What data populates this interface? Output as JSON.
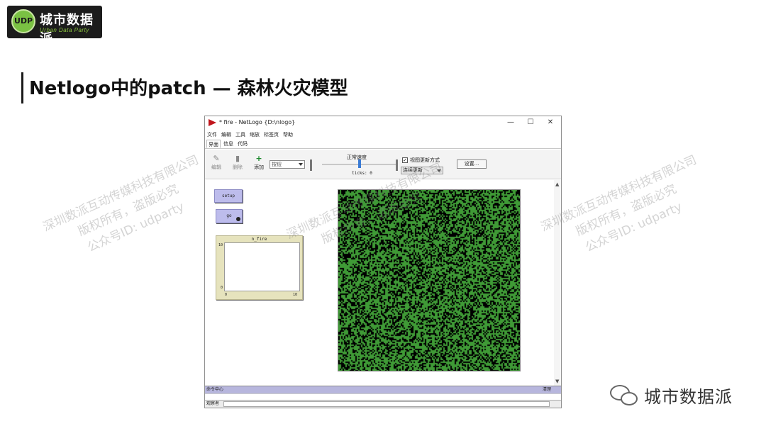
{
  "slide": {
    "logo_badge": "UDP",
    "logo_title": "城市数据派",
    "logo_subtitle": "Urban Data Party",
    "title": "Netlogo中的patch — 森林火灾模型",
    "watermark_line1": "深圳数派互动传媒科技有限公司",
    "watermark_line2": "版权所有，盗版必究",
    "watermark_line3": "公众号ID: udparty",
    "footer_brand": "城市数据派"
  },
  "window": {
    "title": "* fire - NetLogo {D:\\nlogo}",
    "controls": {
      "minimize": "—",
      "maximize": "☐",
      "close": "✕"
    },
    "menu": [
      "文件",
      "编辑",
      "工具",
      "缩放",
      "标签页",
      "帮助"
    ],
    "tabs": [
      "界面",
      "信息",
      "代码"
    ],
    "active_tab": "界面"
  },
  "toolbar": {
    "edit_label": "编辑",
    "delete_label": "删除",
    "add_label": "添加",
    "widget_dropdown": "按钮",
    "speed_label": "正常速度",
    "speed_value": 0.5,
    "ticks_label": "ticks: 0",
    "view_update_checked": true,
    "view_update_label": "视图更新方式",
    "update_mode": "连续更新",
    "settings_label": "设置..."
  },
  "interface": {
    "setup_button": "setup",
    "go_button": "go",
    "plot": {
      "title": "n_fire",
      "y_max": "10",
      "y_min": "0",
      "x_min": "0",
      "x_max": "10"
    },
    "world": {
      "tree_color": "#3f9a36",
      "burned_color": "#000000",
      "tree_density": 0.6
    }
  },
  "command_center": {
    "label": "命令中心",
    "clear_label": "清理",
    "observer_label": "观察者"
  },
  "icons": {
    "edit": "pencil-icon",
    "delete": "trash-icon",
    "add": "plus-icon",
    "app": "netlogo-icon",
    "wechat": "wechat-icon"
  }
}
